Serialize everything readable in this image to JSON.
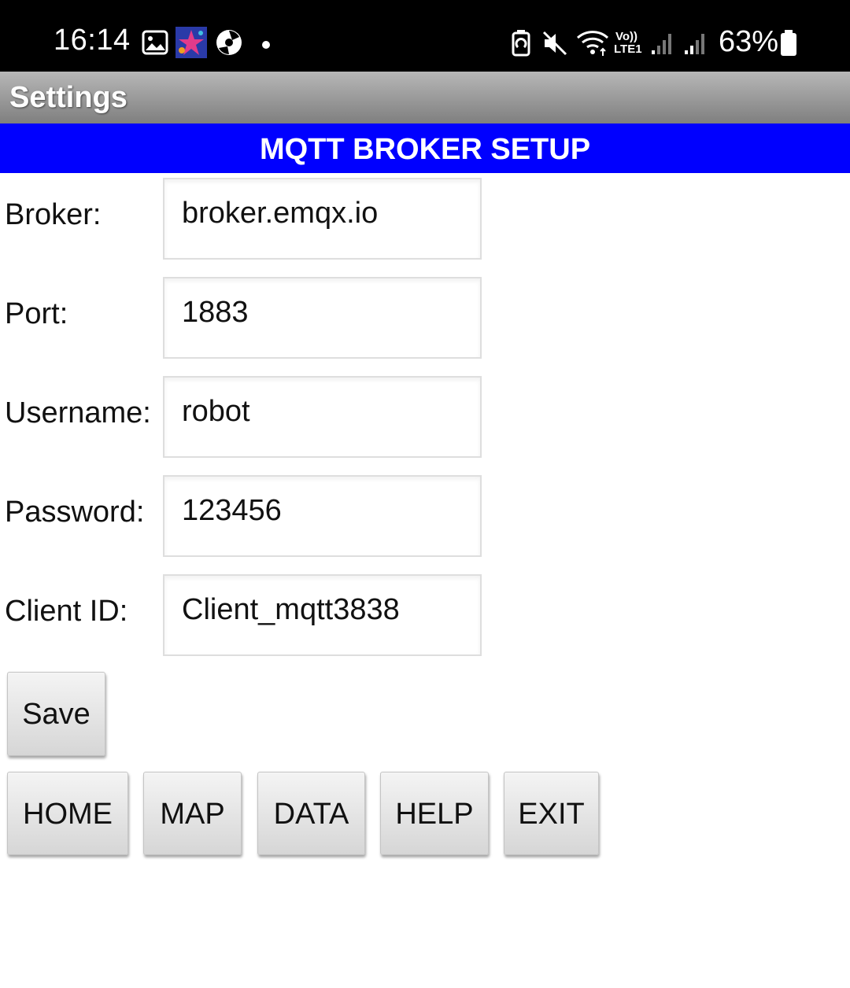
{
  "status_bar": {
    "time": "16:14",
    "battery_percent": "63%",
    "left_icons": [
      "gallery-icon",
      "app-thumbnail-icon",
      "media-disc-icon",
      "notification-dot-icon"
    ],
    "right_icons": [
      "battery-saver-icon",
      "mute-icon",
      "wifi-icon",
      "volte-lte-icon",
      "signal-bars-icon",
      "signal-bars-icon",
      "battery-icon"
    ],
    "volte_text": "Vo))",
    "lte_text": "LTE1"
  },
  "app_bar": {
    "title": "Settings"
  },
  "banner": {
    "text": "MQTT BROKER SETUP",
    "color": "#0000ff"
  },
  "form": {
    "broker": {
      "label": "Broker:",
      "value": "broker.emqx.io"
    },
    "port": {
      "label": "Port:",
      "value": "1883"
    },
    "username": {
      "label": "Username:",
      "value": "robot"
    },
    "password": {
      "label": "Password:",
      "value": "123456"
    },
    "client_id": {
      "label": "Client ID:",
      "value": "Client_mqtt3838"
    }
  },
  "buttons": {
    "save": "Save",
    "home": "HOME",
    "map": "MAP",
    "data": "DATA",
    "help": "HELP",
    "exit": "EXIT"
  }
}
